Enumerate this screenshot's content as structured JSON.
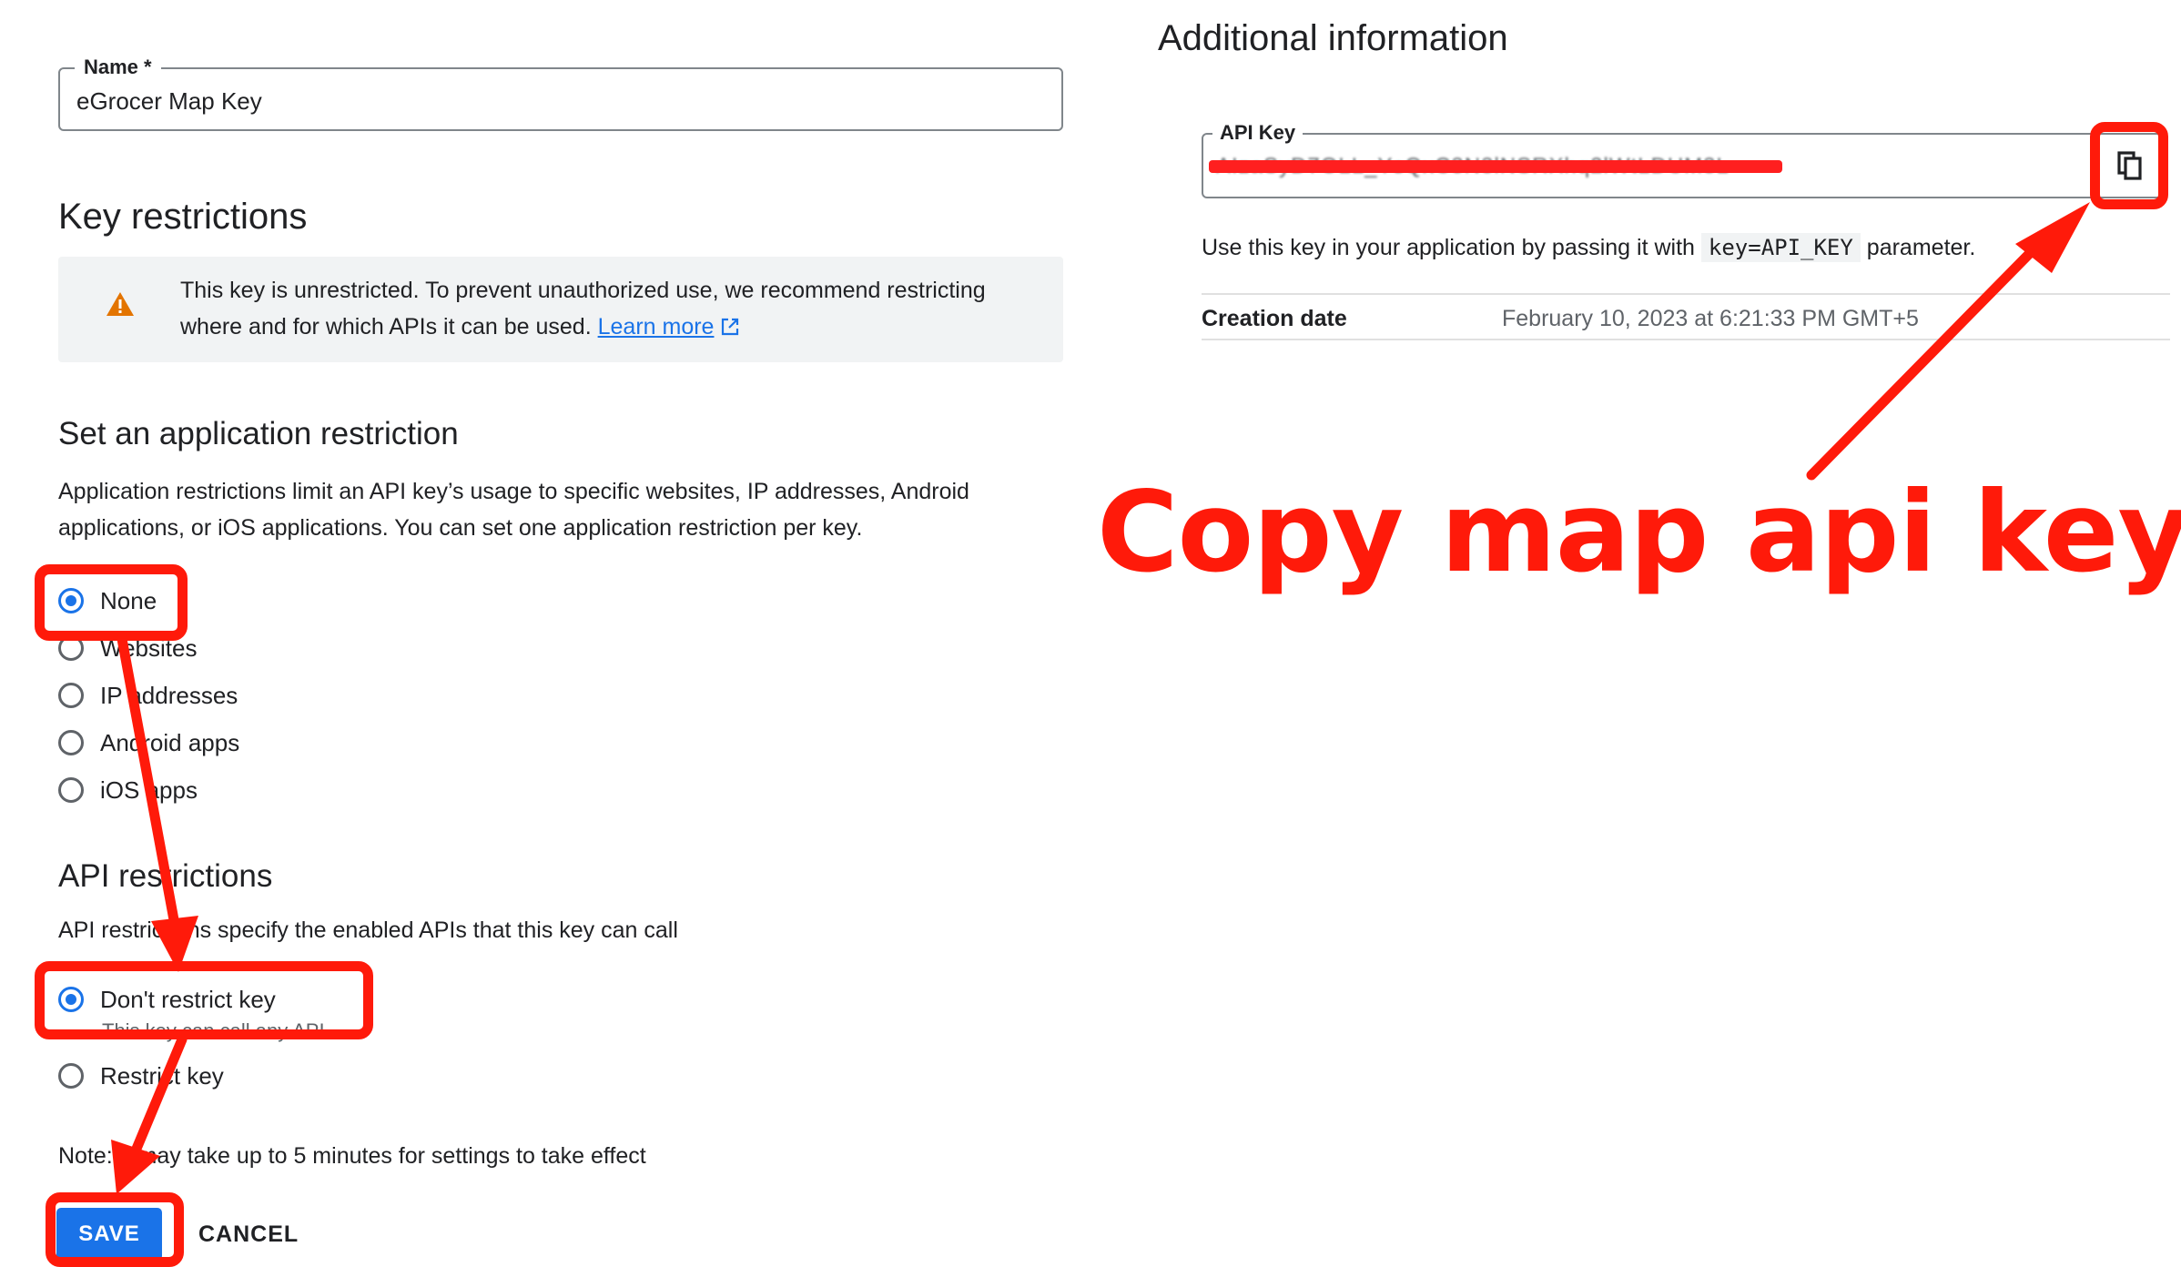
{
  "name_field": {
    "label": "Name *",
    "value": "eGrocer Map Key"
  },
  "key_restrictions": {
    "title": "Key restrictions",
    "warning_text": "This key is unrestricted. To prevent unauthorized use, we recommend restricting where and for which APIs it can be used.",
    "learn_more": "Learn more"
  },
  "app_restriction": {
    "title": "Set an application restriction",
    "description": "Application restrictions limit an API key’s usage to specific websites, IP addresses, Android applications, or iOS applications. You can set one application restriction per key.",
    "options": [
      "None",
      "Websites",
      "IP addresses",
      "Android apps",
      "iOS apps"
    ],
    "selected": "None"
  },
  "api_restrictions": {
    "title": "API restrictions",
    "description": "API restrictions specify the enabled APIs that this key can call",
    "options": [
      "Don't restrict key",
      "Restrict key"
    ],
    "dont_restrict_sub": "This key can call any API",
    "selected": "Don't restrict key"
  },
  "note": "Note: It may take up to 5 minutes for settings to take effect",
  "buttons": {
    "save": "SAVE",
    "cancel": "CANCEL"
  },
  "additional_info": {
    "title": "Additional information",
    "api_key_label": "API Key",
    "api_key_value": "AIzaSyD7OLL_YsQxC3N3lNSRXhq2lWtLDUM3L",
    "usage_prefix": "Use this key in your application by passing it with",
    "usage_code": "key=API_KEY",
    "usage_suffix": "parameter.",
    "creation_label": "Creation date",
    "creation_value": "February 10, 2023 at 6:21:33 PM GMT+5"
  },
  "annotation": {
    "callout": "Copy map api key",
    "color": "#ff1a0a"
  },
  "colors": {
    "accent": "#1a73e8",
    "warning": "#e37400"
  }
}
